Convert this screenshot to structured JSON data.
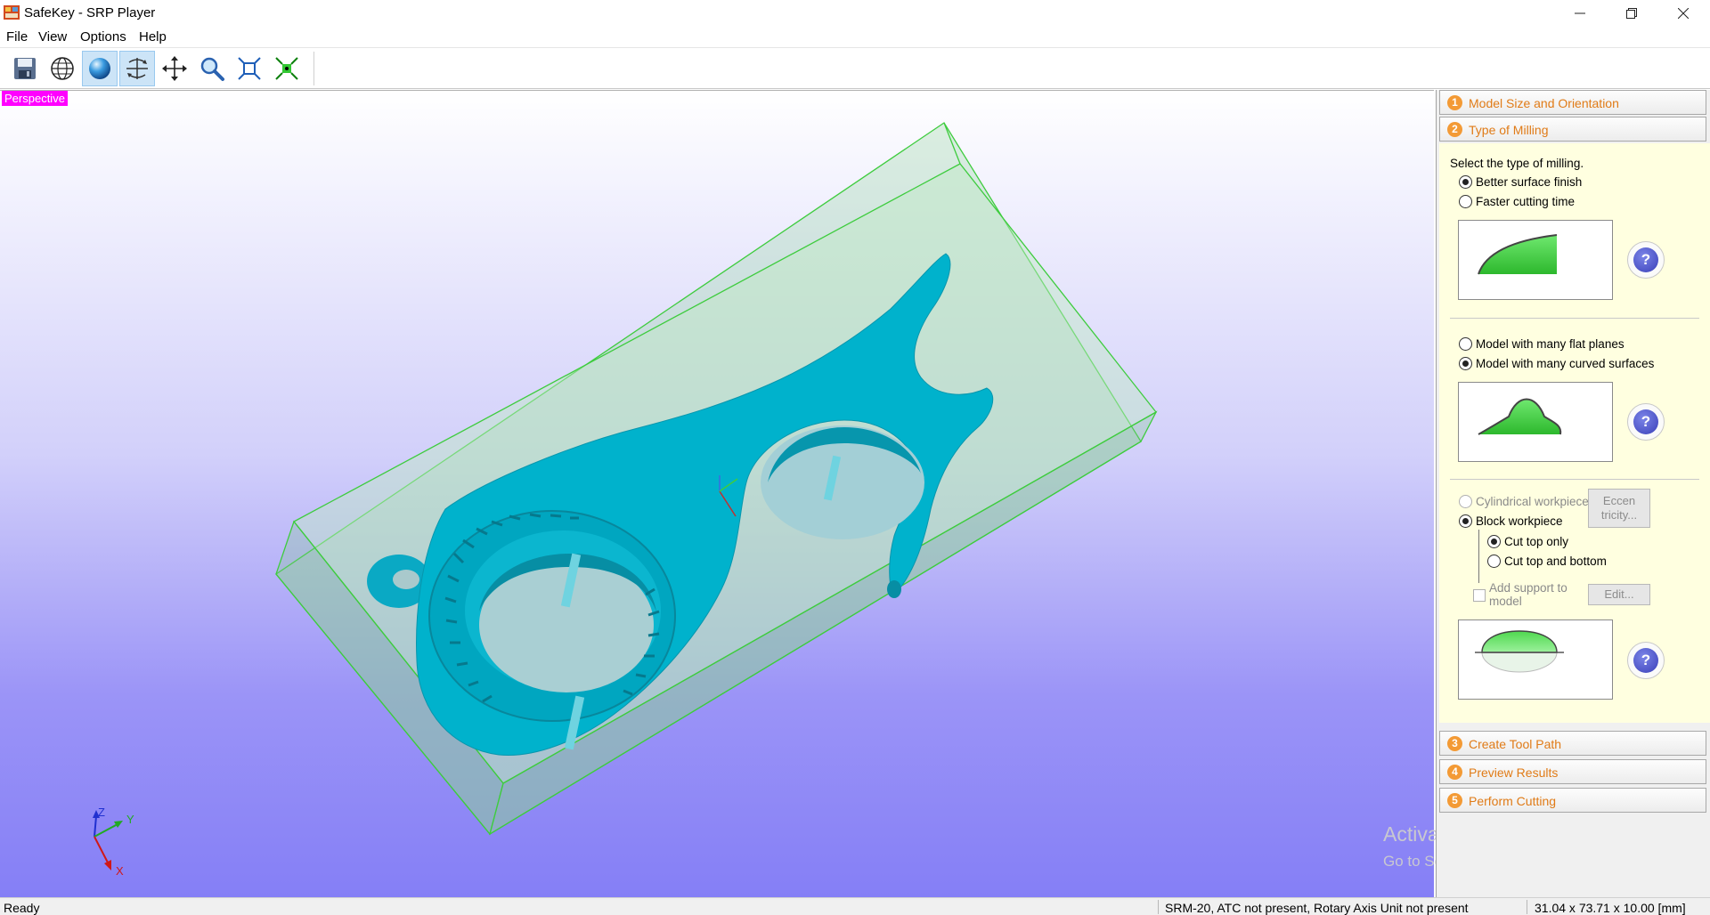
{
  "window": {
    "title": "SafeKey - SRP Player",
    "controls": [
      "minimize",
      "restore",
      "close"
    ]
  },
  "menu": [
    "File",
    "View",
    "Options",
    "Help"
  ],
  "toolbar": {
    "buttons": [
      {
        "name": "save",
        "icon": "save-icon",
        "active": false
      },
      {
        "name": "wireframe",
        "icon": "globe-wireframe-icon",
        "active": false
      },
      {
        "name": "shaded",
        "icon": "shaded-sphere-icon",
        "active": true
      },
      {
        "name": "rotate",
        "icon": "rotate-axes-icon",
        "active": true
      },
      {
        "name": "pan",
        "icon": "move-arrows-icon",
        "active": false
      },
      {
        "name": "zoom",
        "icon": "magnifier-icon",
        "active": false
      },
      {
        "name": "fit",
        "icon": "fit-to-screen-icon",
        "active": false
      },
      {
        "name": "zoom-selection",
        "icon": "zoom-selection-icon",
        "active": false
      }
    ]
  },
  "viewport": {
    "label": "Perspective",
    "axes": {
      "x": "X",
      "y": "Y",
      "z": "Z"
    },
    "colors": {
      "model": "#00b2cc",
      "workpiece_edge": "#3ecc3e",
      "label_bg": "#ff00ff"
    }
  },
  "watermark": {
    "line1": "Activate Windows",
    "line2": "Go to Settings to activate Windows."
  },
  "panel": {
    "steps": [
      {
        "num": "1",
        "label": "Model Size and Orientation"
      },
      {
        "num": "2",
        "label": "Type of Milling"
      },
      {
        "num": "3",
        "label": "Create Tool Path"
      },
      {
        "num": "4",
        "label": "Preview Results"
      },
      {
        "num": "5",
        "label": "Perform Cutting"
      }
    ],
    "milling": {
      "prompt": "Select the type of milling.",
      "finish_options": [
        {
          "label": "Better surface finish",
          "selected": true
        },
        {
          "label": "Faster cutting time",
          "selected": false
        }
      ],
      "model_options": [
        {
          "label": "Model with many flat planes",
          "selected": false
        },
        {
          "label": "Model with many curved surfaces",
          "selected": true
        }
      ],
      "workpiece": {
        "cylindrical": {
          "label": "Cylindrical workpiece",
          "selected": false,
          "enabled": false
        },
        "eccentricity_button": [
          "Eccen",
          "tricity..."
        ],
        "block": {
          "label": "Block workpiece",
          "selected": true
        },
        "cut_options": [
          {
            "label": "Cut top only",
            "selected": true
          },
          {
            "label": "Cut top and bottom",
            "selected": false
          }
        ],
        "support": {
          "label_line1": "Add support to",
          "label_line2": "model",
          "checked": false,
          "enabled": false
        },
        "edit_button": "Edit..."
      },
      "help_label": "?"
    }
  },
  "status": {
    "left": "Ready",
    "machine": "SRM-20, ATC not present, Rotary Axis Unit not present",
    "dimensions": "31.04 x  73.71 x  10.00 [mm]"
  }
}
